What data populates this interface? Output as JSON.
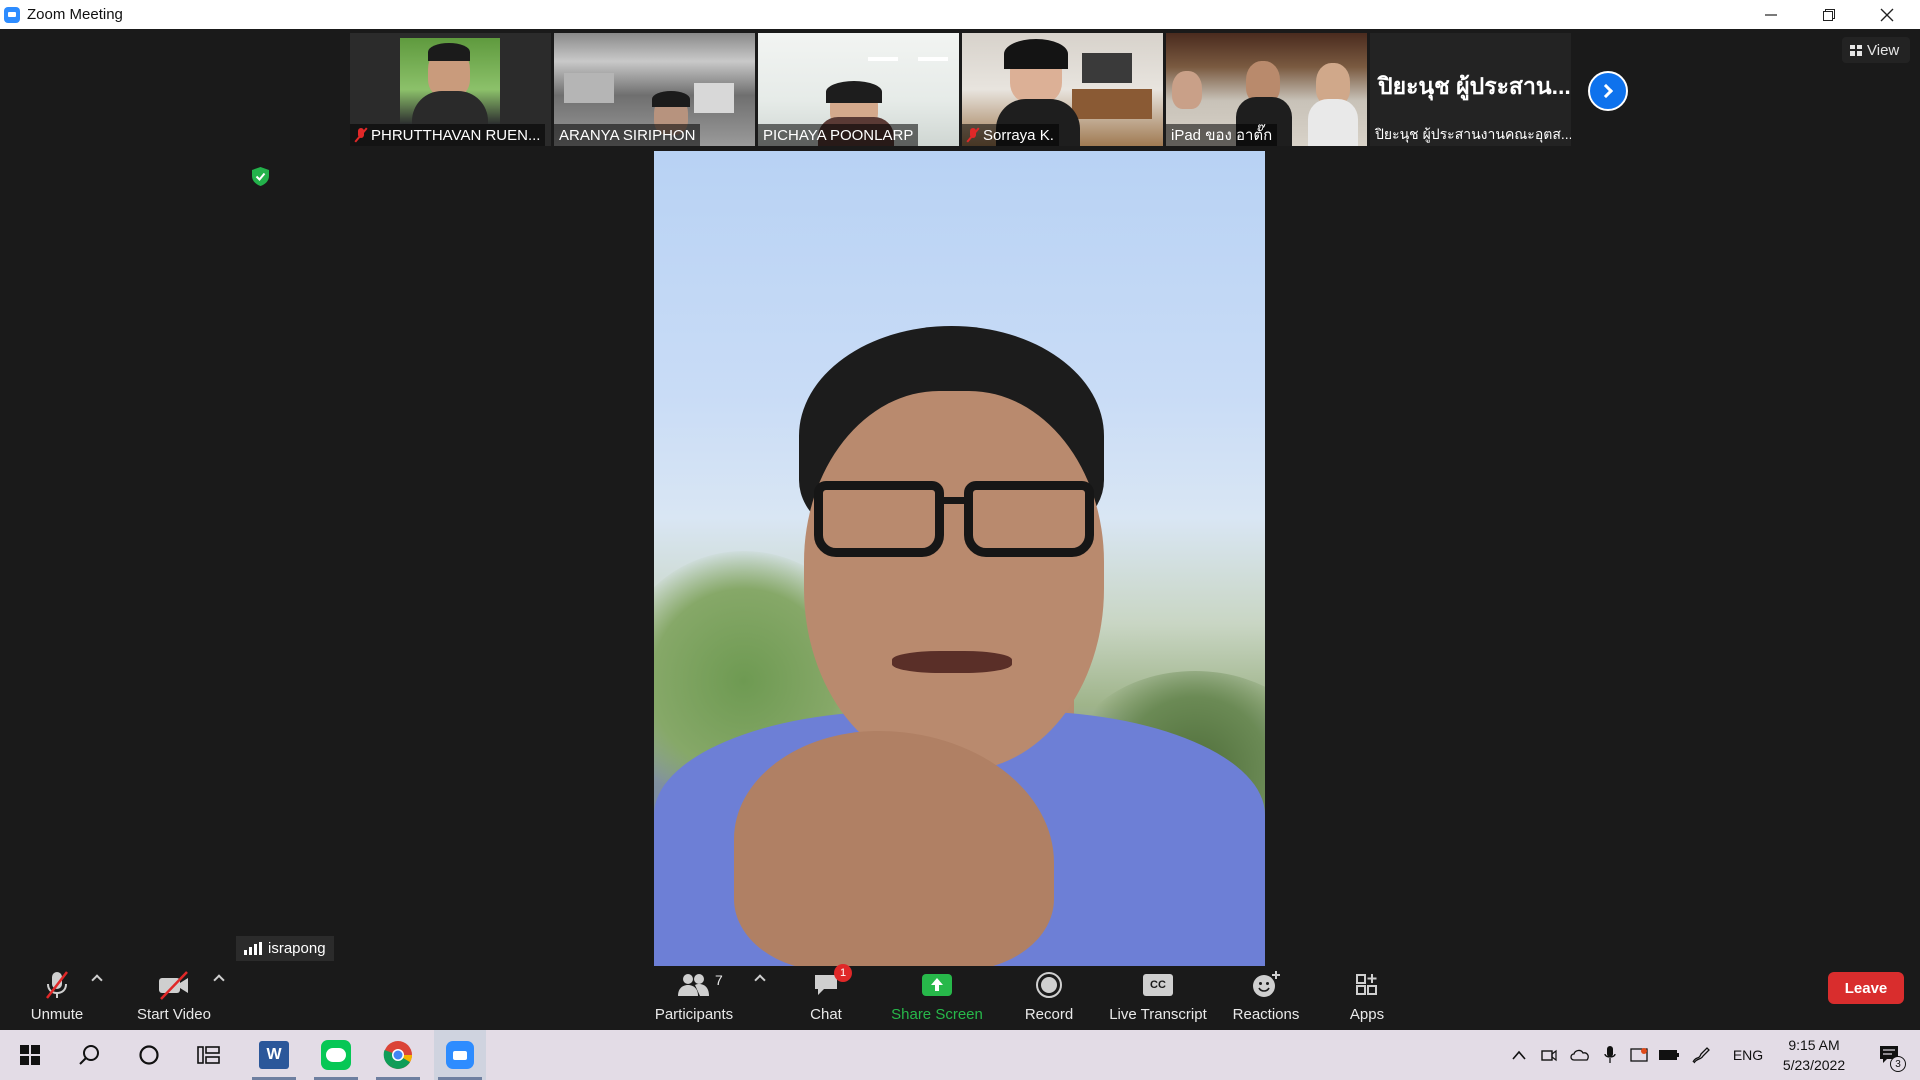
{
  "window": {
    "title": "Zoom Meeting"
  },
  "thumbnails": [
    {
      "name": "PHRUTTHAVAN RUEN...",
      "muted": true
    },
    {
      "name": "ARANYA SIRIPHON",
      "muted": false
    },
    {
      "name": "PICHAYA POONLARP",
      "muted": false
    },
    {
      "name": "Sorraya K.",
      "muted": true
    },
    {
      "name": "iPad ของ อาตั๊ก",
      "muted": false
    },
    {
      "name": "ปิยะนุช ผู้ประสานงานคณะอุตส...",
      "display_text": "ปิยะนุช ผู้ประสาน...",
      "muted": false
    }
  ],
  "view_button": {
    "label": "View"
  },
  "speaker": {
    "name": "israpong"
  },
  "toolbar": {
    "unmute": "Unmute",
    "start_video": "Start Video",
    "participants": "Participants",
    "participants_count": "7",
    "chat": "Chat",
    "chat_badge": "1",
    "share_screen": "Share Screen",
    "record": "Record",
    "live_transcript": "Live Transcript",
    "cc_text": "CC",
    "reactions": "Reactions",
    "apps": "Apps",
    "leave": "Leave"
  },
  "taskbar": {
    "language": "ENG",
    "time": "9:15 AM",
    "date": "5/23/2022",
    "notification_count": "3"
  },
  "colors": {
    "accent_blue": "#0e72ed",
    "share_green": "#27b84a",
    "leave_red": "#d92d2d",
    "muted_red": "#e02828"
  }
}
